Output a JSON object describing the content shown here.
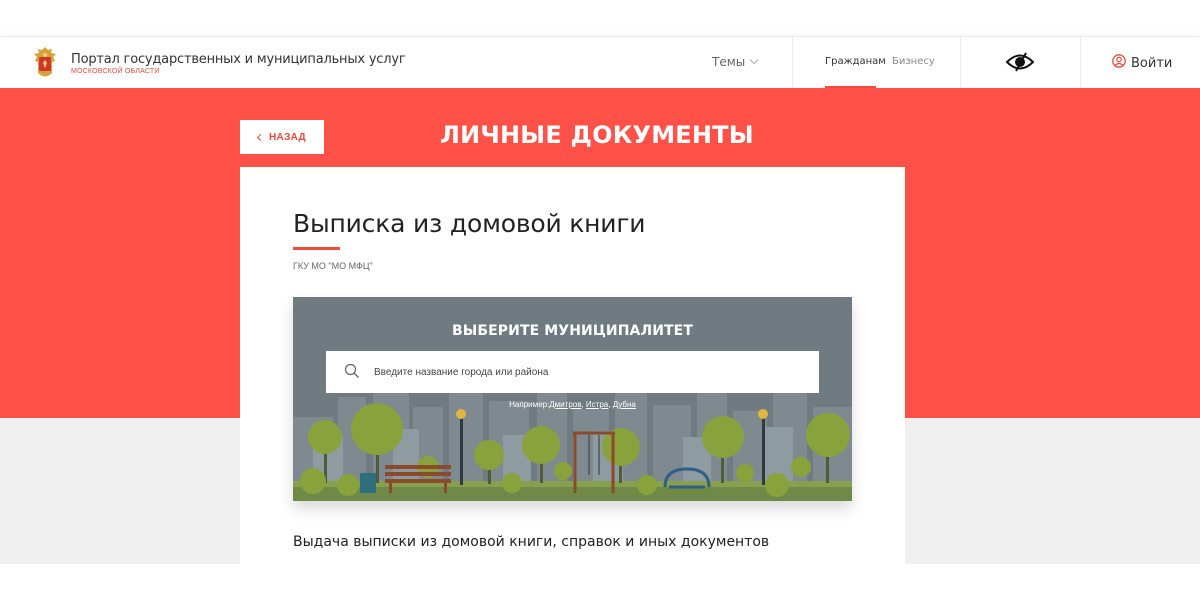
{
  "header": {
    "portal_title": "Портал государственных и муниципальных услуг",
    "portal_subtitle": "МОСКОВСКОЙ ОБЛАСТИ",
    "themes_label": "Темы",
    "tabs": [
      {
        "label": "Гражданам",
        "active": true
      },
      {
        "label": "Бизнесу",
        "active": false
      }
    ],
    "login_label": "Войти",
    "icons": [
      "coat-of-arms-icon",
      "chevron-down-icon",
      "eye-icon",
      "user-icon"
    ]
  },
  "hero": {
    "back_label": "НАЗАД",
    "section_title": "ЛИЧНЫЕ ДОКУМЕНТЫ"
  },
  "card": {
    "title": "Выписка из домовой книги",
    "organization": "ГКУ МО \"МО МФЦ\"",
    "description": "Выдача выписки из домовой книги, справок и иных документов"
  },
  "municipality": {
    "title": "ВЫБЕРИТЕ МУНИЦИПАЛИТЕТ",
    "search_placeholder": "Введите название города или района",
    "example_prefix": "Например:",
    "examples": [
      "Дмитров",
      "Истра",
      "Дубна"
    ],
    "separator": ", "
  },
  "colors": {
    "accent": "#ff5148",
    "accent_dark": "#e64a3c",
    "panel_bg": "#6f7b80",
    "grey_band": "#efefef"
  }
}
